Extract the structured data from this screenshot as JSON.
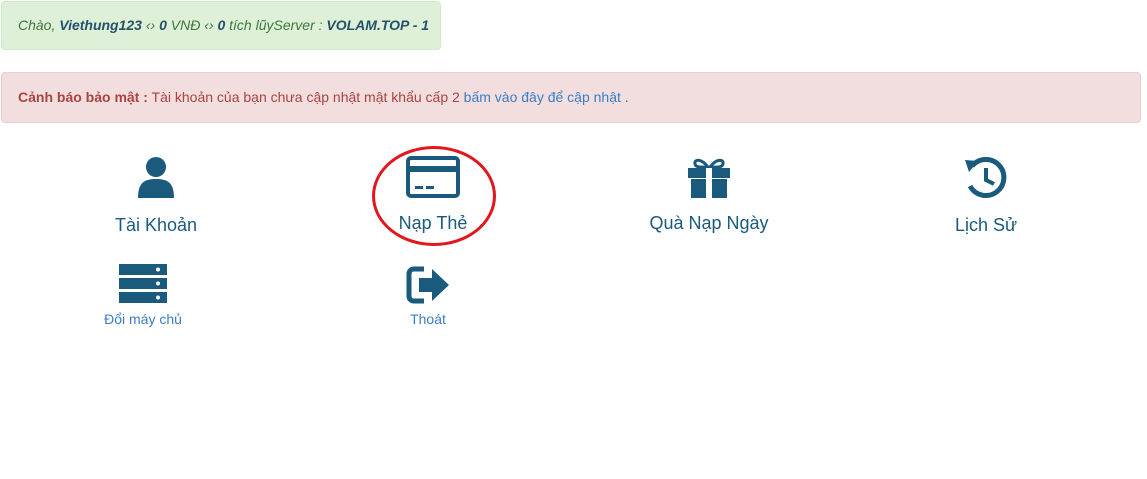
{
  "greeting": {
    "prefix": "Chào, ",
    "username": "Viethung123",
    "sep1": " ‹› ",
    "balance": "0",
    "balance_unit": " VNĐ",
    "sep2": " ‹› ",
    "points": "0",
    "points_label": " tích lũy",
    "server_label": "Server : ",
    "server_name": "VOLAM.TOP - 1"
  },
  "alert": {
    "title": "Cảnh báo bảo mật :",
    "message": " Tài khoản của bạn chưa cập nhật mật khẩu cấp 2 ",
    "link": "bấm vào đây để cập nhật",
    "suffix": " ."
  },
  "menu": {
    "account": "Tài Khoản",
    "topup": "Nạp Thẻ",
    "daily_gift": "Quà Nạp Ngày",
    "history": "Lịch Sử",
    "change_server": "Đổi máy chủ",
    "logout": "Thoát"
  },
  "colors": {
    "icon": "#1a5a7d",
    "highlight_circle": "#e3161d"
  }
}
